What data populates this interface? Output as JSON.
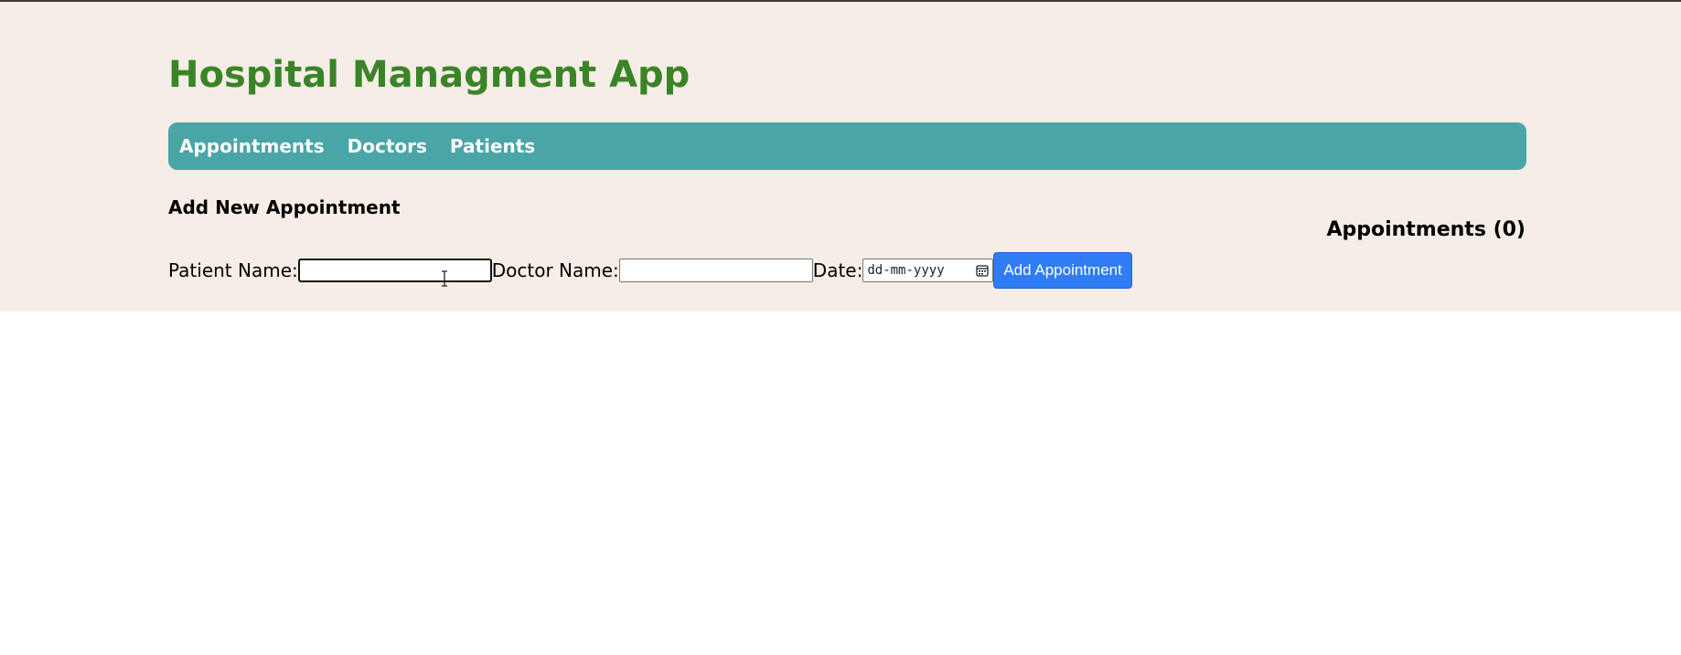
{
  "app": {
    "title": "Hospital Managment App"
  },
  "nav": {
    "items": [
      {
        "label": "Appointments"
      },
      {
        "label": "Doctors"
      },
      {
        "label": "Patients"
      }
    ]
  },
  "form": {
    "heading": "Add New Appointment",
    "patient_label": "Patient Name:",
    "patient_value": "",
    "doctor_label": "Doctor Name:",
    "doctor_value": "",
    "date_label": "Date:",
    "date_placeholder": "dd-mm-yyyy",
    "submit_label": "Add Appointment"
  },
  "appointments": {
    "heading": "Appointments (0)"
  },
  "icons": {
    "date_picker": "calendar-icon",
    "mouse_cursor": "text-cursor-icon"
  },
  "colors": {
    "background": "#f5ede6",
    "title": "#3a8427",
    "navbar": "#4aa5a6",
    "button": "#2f7cf5"
  }
}
